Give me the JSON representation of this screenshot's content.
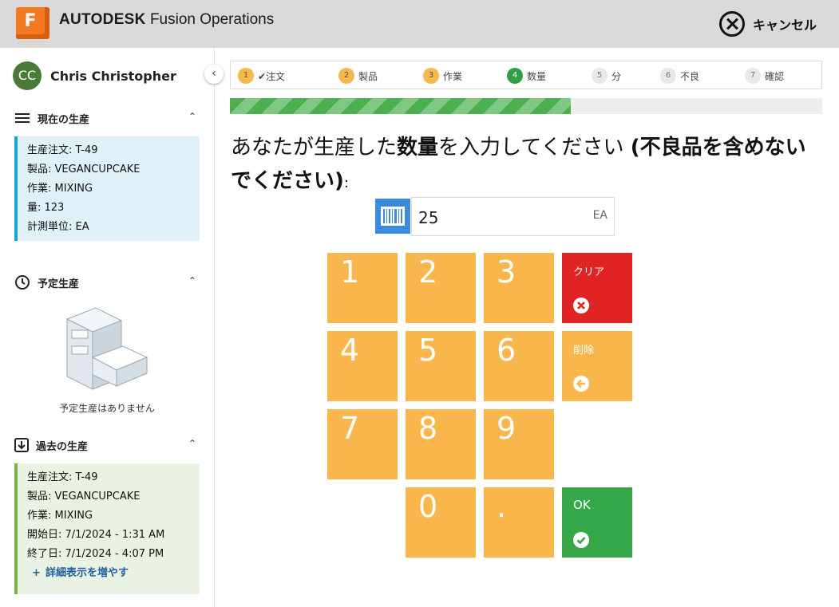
{
  "header": {
    "logo_letter": "F",
    "brand_bold": "AUTODESK",
    "brand_rest": " Fusion Operations",
    "cancel_label": "キャンセル"
  },
  "user": {
    "initials": "CC",
    "name": "Chris Christopher"
  },
  "current": {
    "title": "現在の生産",
    "lines": [
      "生産注文: T-49",
      "製品: VEGANCUPCAKE",
      "作業: MIXING",
      "量: 123",
      "計測単位: EA"
    ]
  },
  "scheduled": {
    "title": "予定生産",
    "empty": "予定生産はありません"
  },
  "past": {
    "title": "過去の生産",
    "lines": [
      "生産注文: T-49",
      "製品: VEGANCUPCAKE",
      "作業: MIXING",
      "開始日: 7/1/2024 - 1:31 AM",
      "終了日: 7/1/2024 - 4:07 PM"
    ],
    "more": "詳細表示を増やす"
  },
  "steps": [
    {
      "num": "1",
      "label": "✔注文"
    },
    {
      "num": "2",
      "label": "製品"
    },
    {
      "num": "3",
      "label": "作業"
    },
    {
      "num": "4",
      "label": "数量"
    },
    {
      "num": "5",
      "label": "分"
    },
    {
      "num": "6",
      "label": "不良"
    },
    {
      "num": "7",
      "label": "確認"
    }
  ],
  "progress_fraction": 0.575,
  "prompt": {
    "part1": "あなたが生産した",
    "bold1": "数量",
    "part2": "を入力してください ",
    "bold2": "(不良品を含めないでください)",
    "colon": ":"
  },
  "quantity": {
    "value": "25",
    "unit": "EA"
  },
  "keypad": {
    "digits": [
      "1",
      "2",
      "3",
      "4",
      "5",
      "6",
      "7",
      "8",
      "9",
      "0",
      "."
    ],
    "clear_label": "クリア",
    "back_label": "削除",
    "ok_label": "OK"
  },
  "colors": {
    "key": "#f9b64c",
    "clear": "#e02424",
    "ok": "#37a84a",
    "progress": "#4caf50",
    "barcode": "#3b8be0"
  }
}
